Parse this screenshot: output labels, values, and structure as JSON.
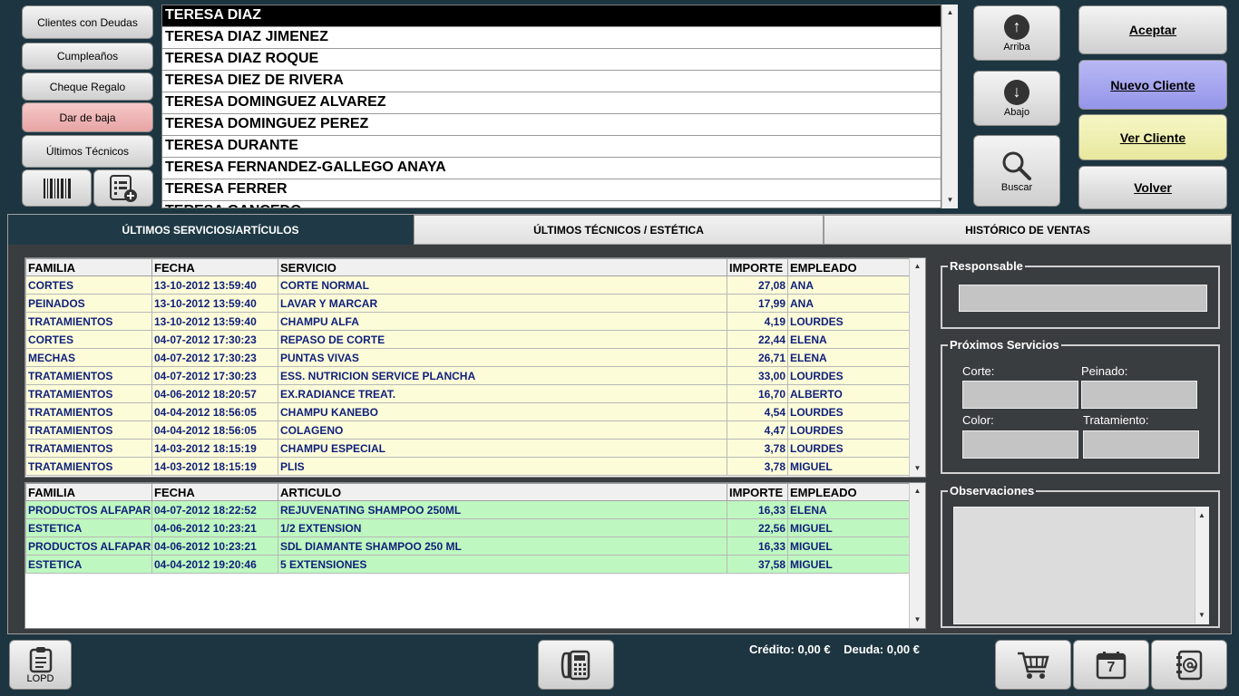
{
  "left_buttons": {
    "clientes_con_deudas": "Clientes con Deudas",
    "cumpleanos": "Cumpleaños",
    "cheque_regalo": "Cheque Regalo",
    "dar_de_baja": "Dar de baja",
    "ultimos_tecnicos": "Últimos Técnicos"
  },
  "clients": [
    "TERESA DIAZ",
    "TERESA DIAZ JIMENEZ",
    "TERESA DIAZ ROQUE",
    "TERESA DIEZ DE RIVERA",
    "TERESA DOMINGUEZ ALVAREZ",
    "TERESA DOMINGUEZ PEREZ",
    "TERESA DURANTE",
    "TERESA FERNANDEZ-GALLEGO ANAYA",
    "TERESA FERRER",
    "TERESA GANCEDO"
  ],
  "nav": {
    "arriba": "Arriba",
    "abajo": "Abajo",
    "buscar": "Buscar"
  },
  "actions": {
    "aceptar": "Aceptar",
    "nuevo_cliente": "Nuevo Cliente",
    "ver_cliente": "Ver Cliente",
    "volver": "Volver"
  },
  "tabs": [
    "ÚLTIMOS SERVICIOS/ARTÍCULOS",
    "ÚLTIMOS TÉCNICOS / ESTÉTICA",
    "HISTÓRICO DE VENTAS"
  ],
  "services": {
    "headers": [
      "FAMILIA",
      "FECHA",
      "SERVICIO",
      "IMPORTE",
      "EMPLEADO"
    ],
    "rows": [
      [
        "CORTES",
        "13-10-2012 13:59:40",
        "CORTE NORMAL",
        "27,08",
        "ANA"
      ],
      [
        "PEINADOS",
        "13-10-2012 13:59:40",
        "LAVAR Y MARCAR",
        "17,99",
        "ANA"
      ],
      [
        "TRATAMIENTOS",
        "13-10-2012 13:59:40",
        "CHAMPU ALFA",
        "4,19",
        "LOURDES"
      ],
      [
        "CORTES",
        "04-07-2012 17:30:23",
        "REPASO DE CORTE",
        "22,44",
        "ELENA"
      ],
      [
        "MECHAS",
        "04-07-2012 17:30:23",
        "PUNTAS VIVAS",
        "26,71",
        "ELENA"
      ],
      [
        "TRATAMIENTOS",
        "04-07-2012 17:30:23",
        "ESS. NUTRICION SERVICE PLANCHA",
        "33,00",
        "LOURDES"
      ],
      [
        "TRATAMIENTOS",
        "04-06-2012 18:20:57",
        "EX.RADIANCE TREAT.",
        "16,70",
        "ALBERTO"
      ],
      [
        "TRATAMIENTOS",
        "04-04-2012 18:56:05",
        "CHAMPU KANEBO",
        "4,54",
        "LOURDES"
      ],
      [
        "TRATAMIENTOS",
        "04-04-2012 18:56:05",
        "COLAGENO",
        "4,47",
        "LOURDES"
      ],
      [
        "TRATAMIENTOS",
        "14-03-2012 18:15:19",
        "CHAMPU ESPECIAL",
        "3,78",
        "LOURDES"
      ],
      [
        "TRATAMIENTOS",
        "14-03-2012 18:15:19",
        "PLIS",
        "3,78",
        "MIGUEL"
      ]
    ]
  },
  "articles": {
    "headers": [
      "FAMILIA",
      "FECHA",
      "ARTICULO",
      "IMPORTE",
      "EMPLEADO"
    ],
    "rows": [
      [
        "PRODUCTOS ALFAPARF",
        "04-07-2012 18:22:52",
        "REJUVENATING SHAMPOO 250ML",
        "16,33",
        "ELENA"
      ],
      [
        "ESTETICA",
        "04-06-2012 10:23:21",
        "1/2 EXTENSION",
        "22,56",
        "MIGUEL"
      ],
      [
        "PRODUCTOS ALFAPARF",
        "04-06-2012 10:23:21",
        "SDL DIAMANTE SHAMPOO 250 ML",
        "16,33",
        "MIGUEL"
      ],
      [
        "ESTETICA",
        "04-04-2012 19:20:46",
        "5 EXTENSIONES",
        "37,58",
        "MIGUEL"
      ]
    ]
  },
  "side": {
    "responsable": "Responsable",
    "proximos": "Próximos Servicios",
    "corte": "Corte:",
    "peinado": "Peinado:",
    "color": "Color:",
    "tratamiento": "Tratamiento:",
    "observaciones": "Observaciones"
  },
  "bottom": {
    "lopd": "LOPD",
    "credito_label": "Crédito:",
    "credito_value": "0,00 €",
    "deuda_label": "Deuda:",
    "deuda_value": "0,00 €",
    "calendar_day": "7"
  }
}
